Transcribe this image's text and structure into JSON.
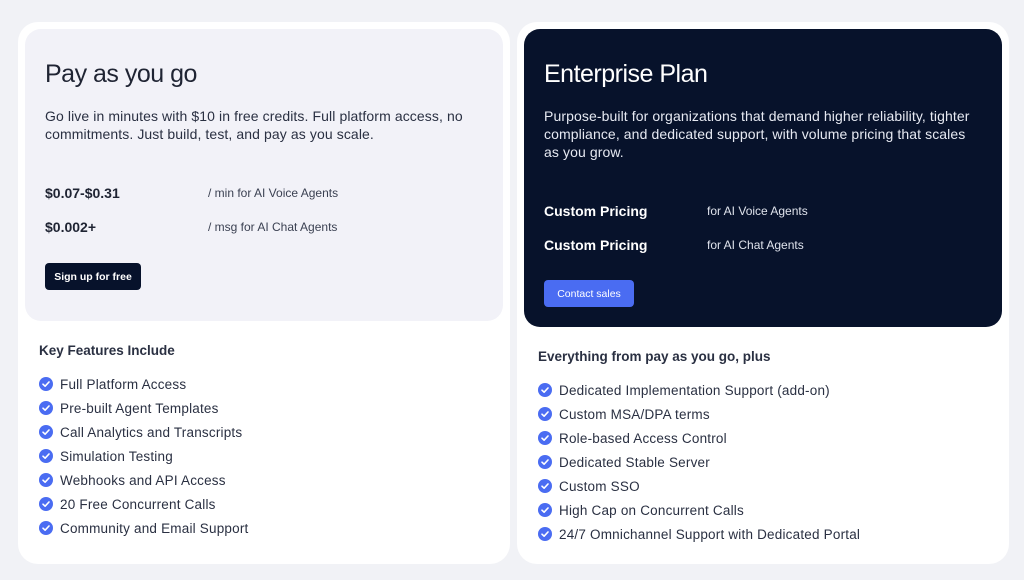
{
  "payg": {
    "title": "Pay as you go",
    "description": "Go live in minutes with $10 in free credits. Full platform access, no commitments. Just build, test, and pay as you scale.",
    "prices": [
      {
        "price": "$0.07-$0.31",
        "unit": "/ min for AI Voice Agents"
      },
      {
        "price": "$0.002+",
        "unit": "/ msg for AI Chat Agents"
      }
    ],
    "cta_label": "Sign up for free",
    "features_heading": "Key Features Include",
    "features": [
      "Full Platform Access",
      "Pre-built Agent Templates",
      "Call Analytics and Transcripts",
      "Simulation Testing",
      "Webhooks and API Access",
      "20 Free Concurrent Calls",
      "Community and Email Support"
    ]
  },
  "enterprise": {
    "title": "Enterprise Plan",
    "description": "Purpose-built for organizations that demand higher reliability, tighter compliance, and dedicated support, with volume pricing that scales as you grow.",
    "prices": [
      {
        "price": "Custom Pricing",
        "unit": "for AI Voice Agents"
      },
      {
        "price": "Custom Pricing",
        "unit": "for AI Chat Agents"
      }
    ],
    "cta_label": "Contact sales",
    "features_heading": "Everything from pay as you go, plus",
    "features": [
      "Dedicated Implementation Support (add-on)",
      "Custom MSA/DPA terms",
      "Role-based Access Control",
      "Dedicated Stable Server",
      "Custom SSO",
      "High Cap on Concurrent Calls",
      "24/7 Omnichannel Support with Dedicated Portal"
    ]
  },
  "icons": {
    "feature_check": "check-circle-icon"
  },
  "colors": {
    "accent": "#4a6cf2",
    "dark_panel": "#07122b",
    "light_panel": "#f2f2f8",
    "page_bg": "#f1f2f6"
  }
}
